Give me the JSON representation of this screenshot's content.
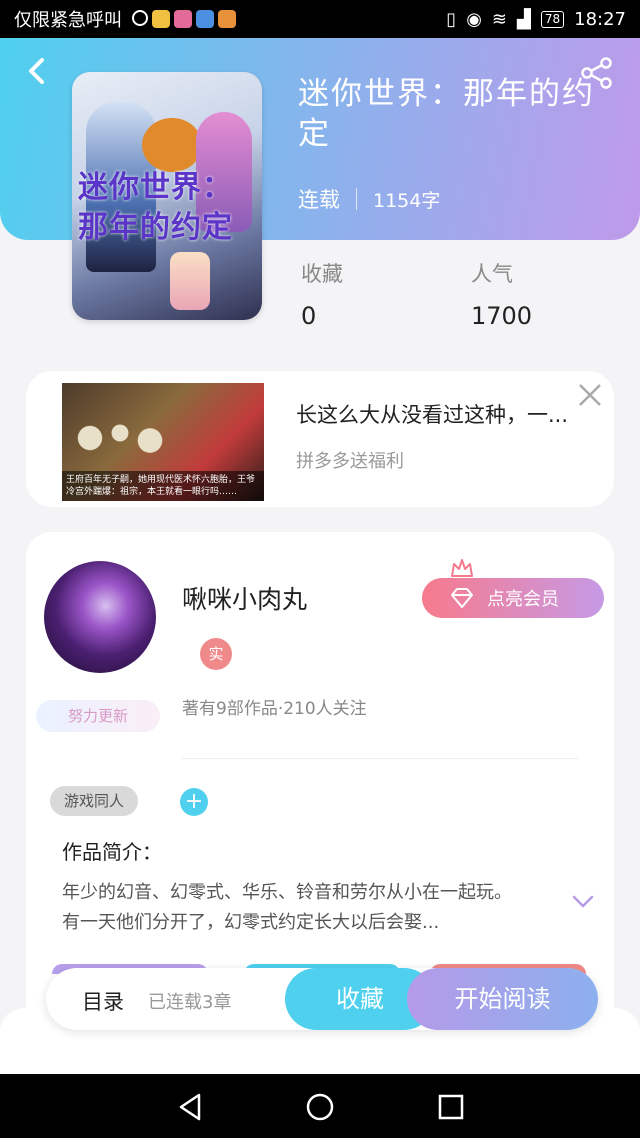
{
  "status_bar": {
    "left_text": "仅限紧急呼叫",
    "battery": "78",
    "time": "18:27"
  },
  "book": {
    "cover_title": "迷你世界：那年的约定",
    "title": "迷你世界：那年的约定",
    "status": "连载",
    "word_count": "1154字",
    "favorites_label": "收藏",
    "favorites_value": "0",
    "popularity_label": "人气",
    "popularity_value": "1700"
  },
  "ad": {
    "title": "长这么大从没看过这种，一...",
    "subtitle": "拼多多送福利",
    "image_caption": "王府百年无子嗣，她用现代医术怀六胞胎，王爷冷宫外踹爆：祖宗，本王就看一眼行吗……"
  },
  "author": {
    "name": "啾咪小肉丸",
    "real_badge": "实",
    "update_badge": "努力更新",
    "vip_button": "点亮会员",
    "stats": "著有9部作品·210人关注"
  },
  "tags": [
    "游戏同人"
  ],
  "add_tag": "+",
  "intro": {
    "label": "作品简介：",
    "text": "年少的幻音、幻零式、华乐、铃音和劳尔从小在一起玩。有一天他们分开了，幻零式约定长大以后会娶..."
  },
  "bottom_bar": {
    "toc_label": "目录",
    "chapters": "已连载3章",
    "collect": "收藏",
    "start_reading": "开始阅读"
  },
  "colors": {
    "accent_cyan": "#4fd0ef",
    "accent_purple": "#bf9aea",
    "vip_pink": "#f77a8c"
  }
}
